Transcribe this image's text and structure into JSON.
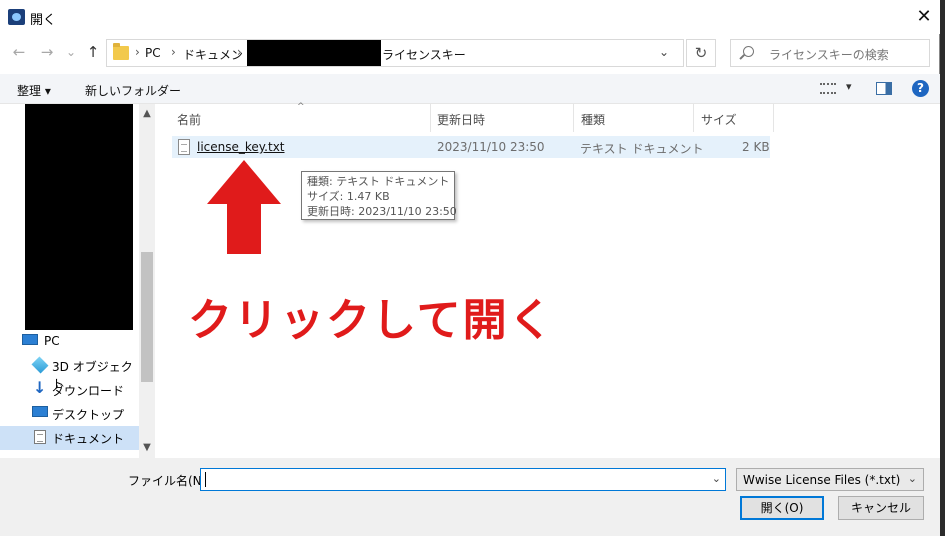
{
  "window": {
    "title": "開く",
    "close_glyph": "✕"
  },
  "nav": {
    "back_glyph": "←",
    "forward_glyph": "→",
    "recent_glyph": "⌄",
    "up_glyph": "↑"
  },
  "address": {
    "crumbs": [
      "PC",
      "ドキュメント",
      "ライセンスキー"
    ],
    "separator": "›",
    "dropdown_glyph": "⌄",
    "refresh_glyph": "↻"
  },
  "search": {
    "placeholder": "ライセンスキーの検索"
  },
  "toolbar": {
    "organize_label": "整理 ▾",
    "new_folder_label": "新しいフォルダー",
    "view_dropdown_glyph": "▾",
    "help_glyph": "?"
  },
  "sidebar": {
    "items": [
      {
        "label": "PC",
        "icon": "pc-icon"
      },
      {
        "label": "3D オブジェクト",
        "icon": "3d-objects-icon"
      },
      {
        "label": "ダウンロード",
        "icon": "download-icon"
      },
      {
        "label": "デスクトップ",
        "icon": "desktop-icon"
      },
      {
        "label": "ドキュメント",
        "icon": "documents-icon",
        "selected": true
      }
    ]
  },
  "columns": {
    "name": "名前",
    "date": "更新日時",
    "type": "種類",
    "size": "サイズ"
  },
  "files": [
    {
      "name": "license_key.txt",
      "date": "2023/11/10 23:50",
      "type": "テキスト ドキュメント",
      "size": "2 KB"
    }
  ],
  "tooltip": {
    "type_line": "種類: テキスト ドキュメント",
    "size_line": "サイズ: 1.47 KB",
    "date_line": "更新日時: 2023/11/10 23:50"
  },
  "annotation": {
    "text": "クリックして開く",
    "color": "#e01b1b"
  },
  "footer": {
    "filename_label": "ファイル名(N):",
    "filename_value": "",
    "filter_value": "Wwise License Files (*.txt)",
    "dropdown_glyph": "⌄",
    "open_button": "開く(O)",
    "cancel_button": "キャンセル"
  },
  "colors": {
    "accent": "#0078d7",
    "selection": "#cde1f7",
    "hover_row": "#e5f1fb"
  }
}
